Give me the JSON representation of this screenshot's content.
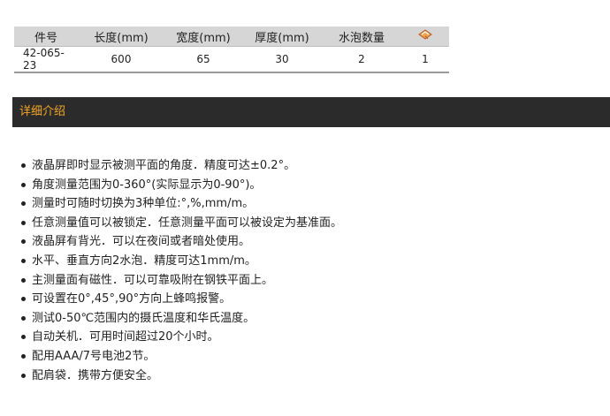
{
  "spec_table": {
    "headers": [
      "件号",
      "长度(mm)",
      "宽度(mm)",
      "厚度(mm)",
      "水泡数量"
    ],
    "cart_icon": "cart-icon",
    "row": {
      "part_no": "42-065-23",
      "length": "600",
      "width": "65",
      "thickness": "30",
      "bubbles": "2",
      "qty": "1"
    }
  },
  "detail_section": {
    "title": "详细介绍",
    "bar_color": "#2b2b2b",
    "title_color": "#f5a623"
  },
  "features": [
    "液晶屏即时显示被测平面的角度．精度可达±0.2°。",
    "角度测量范围为0-360°(实际显示为0-90°)。",
    "测量时可随时切换为3种单位:°,%,mm/m。",
    "任意测量值可以被锁定．任意测量平面可以被设定为基准面。",
    "液晶屏有背光．可以在夜间或者暗处使用。",
    "水平、垂直方向2水泡．精度可达1mm/m。",
    "主测量面有磁性．可以可靠吸附在钢铁平面上。",
    "可设置在0°,45°,90°方向上蜂鸣报警。",
    "测试0-50℃范围内的摄氏温度和华氏温度。",
    "自动关机．可用时间超过20个小时。",
    "配用AAA/7号电池2节。",
    "配肩袋．携带方便安全。"
  ]
}
